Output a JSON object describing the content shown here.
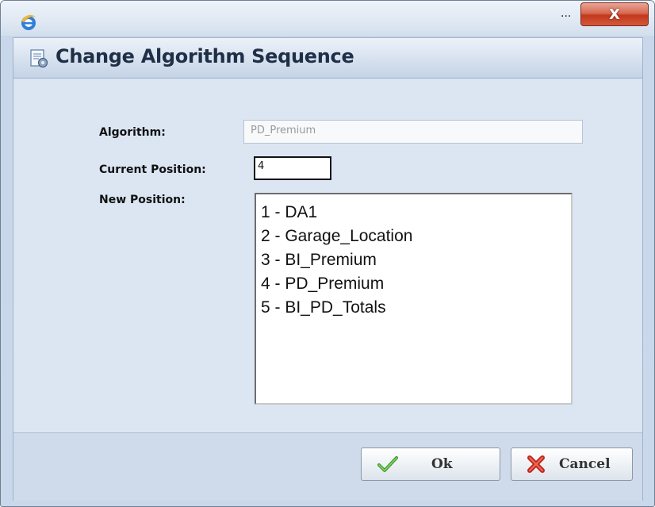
{
  "window": {
    "title_suffix": "...",
    "close_glyph": "X"
  },
  "dialog": {
    "title": "Change Algorithm Sequence"
  },
  "form": {
    "algorithm_label": "Algorithm:",
    "algorithm_value": "PD_Premium",
    "current_position_label": "Current Position:",
    "current_position_value": "4",
    "new_position_label": "New Position:",
    "positions": [
      "1 - DA1",
      "2 - Garage_Location",
      "3 - BI_Premium",
      "4 - PD_Premium",
      "5 - BI_PD_Totals"
    ]
  },
  "buttons": {
    "ok_label": "Ok",
    "cancel_label": "Cancel"
  },
  "icons": {
    "window": "internet-explorer-icon",
    "header": "document-gear-icon",
    "ok": "green-checkmark-icon",
    "cancel": "red-x-icon"
  }
}
